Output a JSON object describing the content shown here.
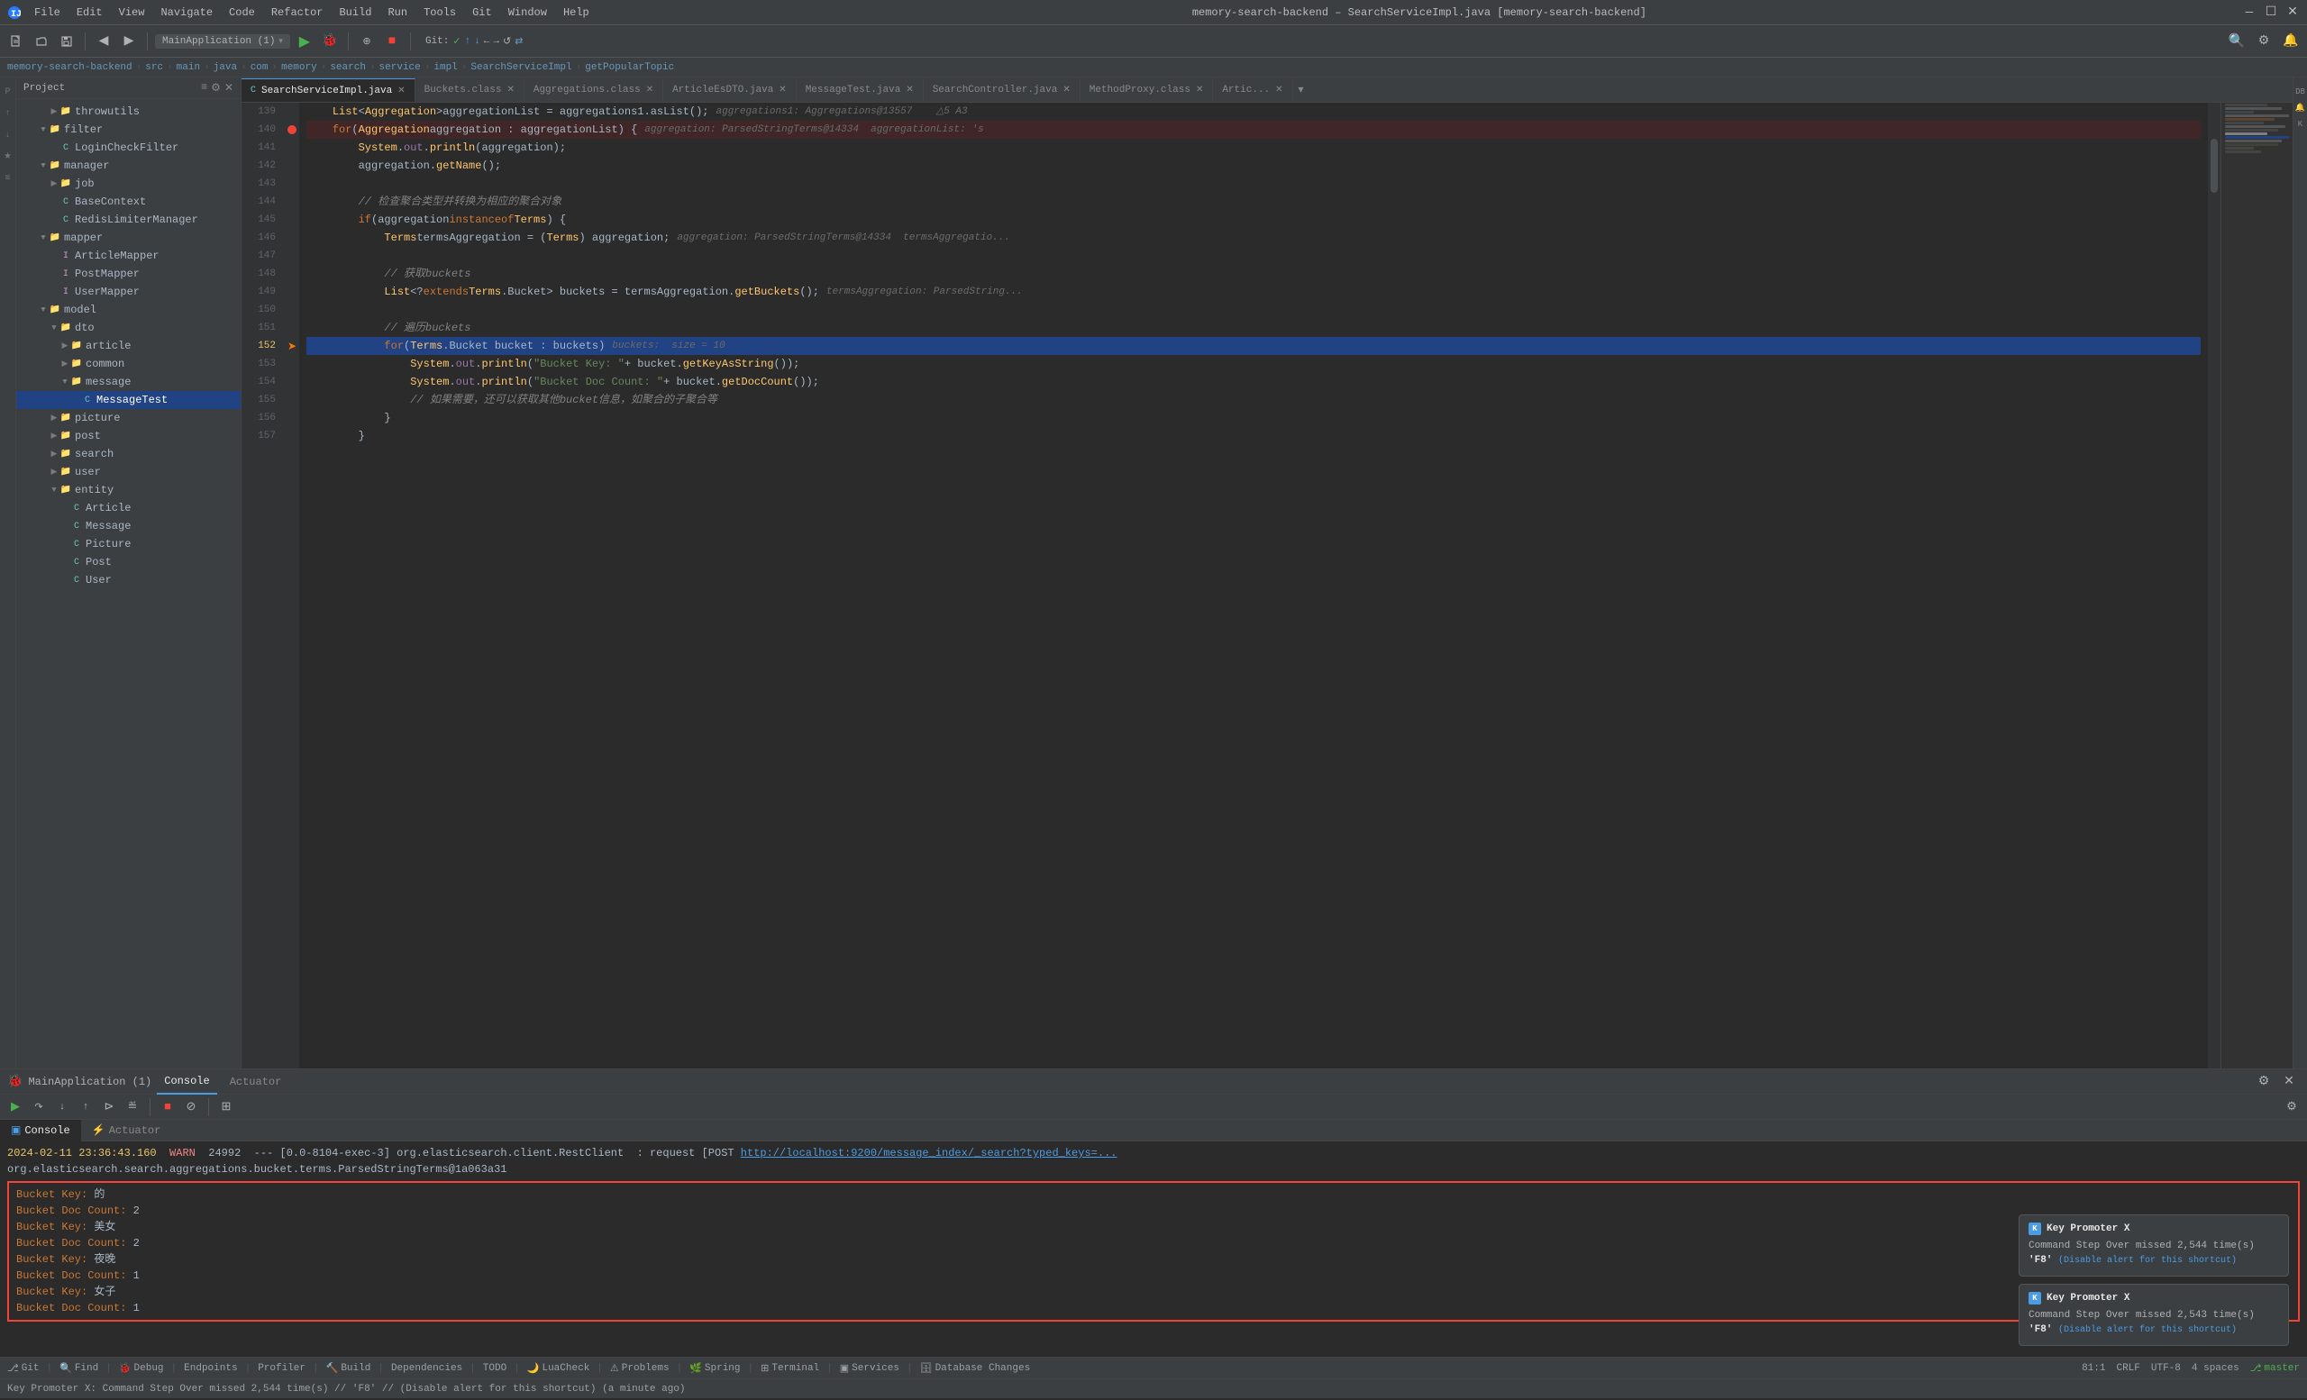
{
  "window": {
    "title": "memory-search-backend – SearchServiceImpl.java [memory-search-backend]",
    "minimize": "—",
    "maximize": "☐",
    "close": "✕"
  },
  "menus": [
    "File",
    "Edit",
    "View",
    "Navigate",
    "Code",
    "Refactor",
    "Build",
    "Run",
    "Tools",
    "Git",
    "Window",
    "Help"
  ],
  "toolbar": {
    "branch": "MainApplication (1)",
    "git_label": "Git:",
    "git_status": "✓ ↑ ↓ ← →"
  },
  "breadcrumb": {
    "items": [
      "memory-search-backend",
      "src",
      "main",
      "java",
      "com",
      "memory",
      "search",
      "service",
      "impl",
      "SearchServiceImpl",
      "getPopularTopic"
    ]
  },
  "tabs": [
    {
      "name": "SearchServiceImpl.java",
      "active": true,
      "modified": false
    },
    {
      "name": "Buckets.class",
      "active": false
    },
    {
      "name": "Aggregations.class",
      "active": false
    },
    {
      "name": "ArticleEsDTO.java",
      "active": false
    },
    {
      "name": "MessageTest.java",
      "active": false
    },
    {
      "name": "SearchController.java",
      "active": false
    },
    {
      "name": "MethodProxy.class",
      "active": false
    },
    {
      "name": "Artic...",
      "active": false
    }
  ],
  "project": {
    "title": "Project",
    "nodes": [
      {
        "label": "throwutils",
        "type": "folder",
        "level": 3
      },
      {
        "label": "filter",
        "type": "folder",
        "level": 2,
        "expanded": true
      },
      {
        "label": "LoginCheckFilter",
        "type": "java",
        "level": 3
      },
      {
        "label": "manager",
        "type": "folder",
        "level": 2,
        "expanded": true
      },
      {
        "label": "job",
        "type": "folder",
        "level": 3,
        "expanded": false
      },
      {
        "label": "BaseContext",
        "type": "java",
        "level": 3
      },
      {
        "label": "RedisLimiterManager",
        "type": "java",
        "level": 3
      },
      {
        "label": "mapper",
        "type": "folder",
        "level": 2,
        "expanded": true
      },
      {
        "label": "ArticleMapper",
        "type": "interface",
        "level": 3
      },
      {
        "label": "PostMapper",
        "type": "interface",
        "level": 3
      },
      {
        "label": "UserMapper",
        "type": "interface",
        "level": 3
      },
      {
        "label": "model",
        "type": "folder",
        "level": 2,
        "expanded": true
      },
      {
        "label": "dto",
        "type": "folder",
        "level": 3,
        "expanded": true
      },
      {
        "label": "article",
        "type": "folder",
        "level": 4
      },
      {
        "label": "common",
        "type": "folder",
        "level": 4
      },
      {
        "label": "message",
        "type": "folder",
        "level": 4,
        "expanded": true
      },
      {
        "label": "MessageTest",
        "type": "java",
        "level": 5,
        "selected": true
      },
      {
        "label": "picture",
        "type": "folder",
        "level": 3
      },
      {
        "label": "post",
        "type": "folder",
        "level": 3
      },
      {
        "label": "search",
        "type": "folder",
        "level": 3
      },
      {
        "label": "user",
        "type": "folder",
        "level": 3
      },
      {
        "label": "entity",
        "type": "folder",
        "level": 3,
        "expanded": true
      },
      {
        "label": "Article",
        "type": "java",
        "level": 4
      },
      {
        "label": "Message",
        "type": "java",
        "level": 4
      },
      {
        "label": "Picture",
        "type": "java",
        "level": 4
      },
      {
        "label": "Post",
        "type": "java",
        "level": 4
      },
      {
        "label": "User",
        "type": "java",
        "level": 4
      }
    ]
  },
  "code": {
    "lines": [
      {
        "num": 139,
        "text": "    List<Aggregation> aggregationList = aggregations1.asList();",
        "hint": "  aggregations1: Aggregations@13557     △5  A3",
        "bp": false,
        "highlight": false
      },
      {
        "num": 140,
        "text": "    for (Aggregation aggregation : aggregationList) {",
        "hint": "  aggregation: ParsedStringTerms@14334     aggregationList: 's",
        "bp": true,
        "highlight": false
      },
      {
        "num": 141,
        "text": "        System.out.println(aggregation);",
        "hint": "",
        "bp": false,
        "highlight": false
      },
      {
        "num": 142,
        "text": "        aggregation.getName();",
        "hint": "",
        "bp": false,
        "highlight": false
      },
      {
        "num": 143,
        "text": "",
        "hint": "",
        "bp": false,
        "highlight": false
      },
      {
        "num": 144,
        "text": "        // 检查聚合类型并转换为相应的聚合对象",
        "hint": "",
        "bp": false,
        "highlight": false
      },
      {
        "num": 145,
        "text": "        if (aggregation instanceof Terms) {",
        "hint": "",
        "bp": false,
        "highlight": false
      },
      {
        "num": 146,
        "text": "            Terms termsAggregation = (Terms) aggregation;",
        "hint": "  aggregation: ParsedStringTerms@14334     termsAggregatio...",
        "bp": false,
        "highlight": false
      },
      {
        "num": 147,
        "text": "",
        "hint": "",
        "bp": false,
        "highlight": false
      },
      {
        "num": 148,
        "text": "            // 获取buckets",
        "hint": "",
        "bp": false,
        "highlight": false
      },
      {
        "num": 149,
        "text": "            List<? extends Terms.Bucket> buckets = termsAggregation.getBuckets();",
        "hint": "  termsAggregation: ParsedString...",
        "bp": false,
        "highlight": false
      },
      {
        "num": 150,
        "text": "",
        "hint": "",
        "bp": false,
        "highlight": false
      },
      {
        "num": 151,
        "text": "            // 遍历buckets",
        "hint": "",
        "bp": false,
        "highlight": false
      },
      {
        "num": 152,
        "text": "            for (Terms.Bucket bucket : buckets)",
        "hint": "  buckets:  size = 10",
        "bp": false,
        "highlight": true
      },
      {
        "num": 153,
        "text": "                System.out.println(\"Bucket Key: \" + bucket.getKeyAsString());",
        "hint": "",
        "bp": false,
        "highlight": false
      },
      {
        "num": 154,
        "text": "                System.out.println(\"Bucket Doc Count: \" + bucket.getDocCount());",
        "hint": "",
        "bp": false,
        "highlight": false
      },
      {
        "num": 155,
        "text": "                // 如果需要，还可以获取其他bucket信息，如聚合的子聚合等",
        "hint": "",
        "bp": false,
        "highlight": false
      },
      {
        "num": 156,
        "text": "            }",
        "hint": "",
        "bp": false,
        "highlight": false
      },
      {
        "num": 157,
        "text": "        }",
        "hint": "",
        "bp": false,
        "highlight": false
      }
    ]
  },
  "debug": {
    "app_name": "MainApplication (1)",
    "tabs": [
      "Console",
      "Actuator"
    ],
    "active_tab": "Console",
    "console_tabs": [
      "Console",
      "Actuator"
    ],
    "log_line1": "2024-02-11 23:36:43.160",
    "log_level1": "WARN",
    "log_pid1": "24992",
    "log_thread1": "--- [0.0-8104-exec-3]",
    "log_class1": "org.elasticsearch.client.RestClient",
    "log_msg1": ": request [POST",
    "log_url1": "http://localhost:9200/message_index/_search?typed_keys=...",
    "log_line2": "org.elasticsearch.search.aggregations.bucket.terms.ParsedStringTerms@1a063a31",
    "console_output": [
      "Bucket Key: 的",
      "Bucket Doc Count: 2",
      "Bucket Key: 美女",
      "Bucket Doc Count: 2",
      "Bucket Key: 夜晚",
      "Bucket Doc Count: 1",
      "Bucket Key: 女子",
      "Bucket Doc Count: 1"
    ]
  },
  "status_bar": {
    "git_branch": "Git",
    "find": "Find",
    "debug_label": "Debug",
    "endpoints": "Endpoints",
    "profiler": "Profiler",
    "build": "Build",
    "dependencies": "Dependencies",
    "todo": "TODO",
    "lua_check": "LuaCheck",
    "problems": "Problems",
    "spring": "Spring",
    "terminal": "Terminal",
    "services": "Services",
    "db_changes": "Database Changes",
    "position": "81:1",
    "crlf": "CRLF",
    "encoding": "UTF-8",
    "indent": "4 spaces",
    "branch": "master",
    "message": "Key Promoter X: Command Step Over missed 2,544 time(s) // 'F8' // (Disable alert for this shortcut) (a minute ago)"
  },
  "key_promoter": [
    {
      "title": "Key Promoter X",
      "command": "Command Step Over missed 2,544 time(s)",
      "shortcut": "'F8'",
      "disable_link": "(Disable alert for this shortcut)"
    },
    {
      "title": "Key Promoter X",
      "command": "Command Step Over missed 2,543 time(s)",
      "shortcut": "'F8'",
      "disable_link": "(Disable alert for this shortcut)"
    }
  ]
}
